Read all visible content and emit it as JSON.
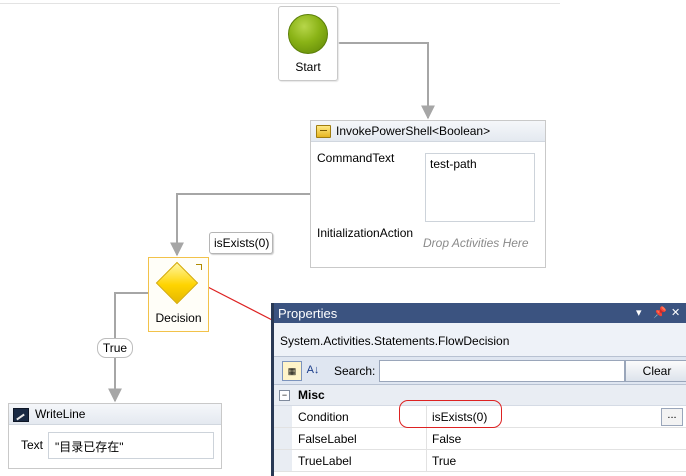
{
  "flowchart": {
    "start": {
      "label": "Start"
    },
    "invoke": {
      "title": "InvokePowerShell<Boolean>",
      "command_text_label": "CommandText",
      "command_text_value": "test-path",
      "initialization_label": "InitializationAction",
      "drop_hint": "Drop Activities Here"
    },
    "decision": {
      "label": "Decision",
      "condition_tag": "isExists(0)",
      "true_label": "True"
    },
    "writeline": {
      "title": "WriteLine",
      "text_label": "Text",
      "text_value": "\"目录已存在\""
    }
  },
  "properties": {
    "title": "Properties",
    "title_controls": [
      "▾",
      "📌",
      "✕"
    ],
    "type_name": "System.Activities.Statements.FlowDecision",
    "search_label": "Search:",
    "search_value": "",
    "clear_label": "Clear",
    "category": "Misc",
    "rows": [
      {
        "name": "Condition",
        "value": "isExists(0)"
      },
      {
        "name": "FalseLabel",
        "value": "False"
      },
      {
        "name": "TrueLabel",
        "value": "True"
      }
    ],
    "ellipsis_label": "..."
  },
  "colors": {
    "panel_title": "#3b5380",
    "highlight": "#dd2222",
    "connector": "#a6a6a6"
  }
}
